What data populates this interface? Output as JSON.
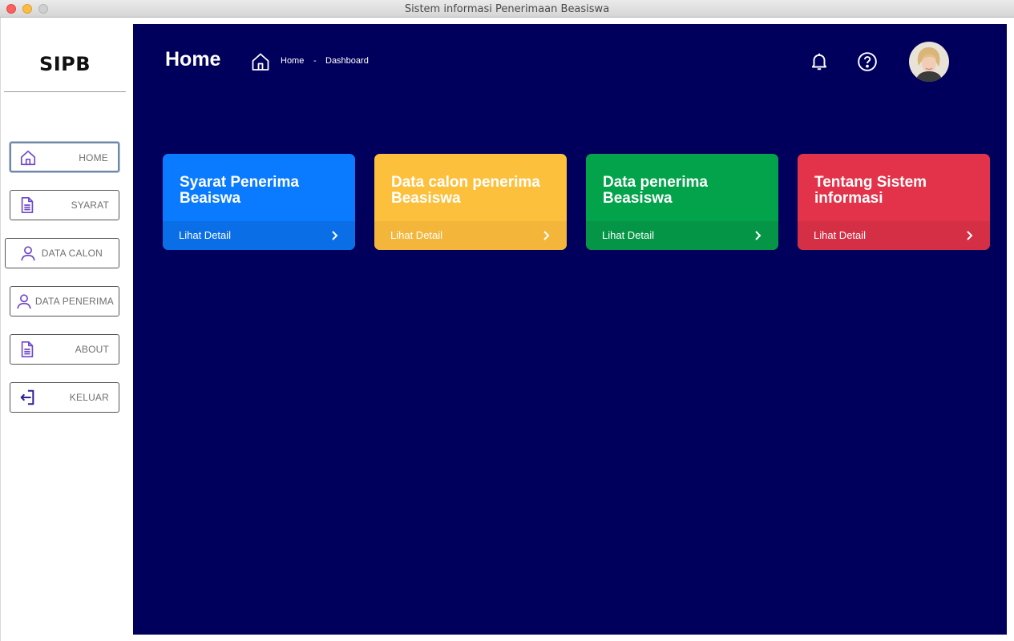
{
  "window": {
    "title": "Sistem informasi Penerimaan Beasiswa"
  },
  "sidebar": {
    "logo": "SIPB",
    "items": [
      {
        "label": "HOME",
        "icon": "home-icon"
      },
      {
        "label": "SYARAT",
        "icon": "document-icon"
      },
      {
        "label": "DATA CALON",
        "icon": "user-icon"
      },
      {
        "label": "DATA PENERIMA",
        "icon": "user-icon"
      },
      {
        "label": "ABOUT",
        "icon": "document-icon"
      },
      {
        "label": "KELUAR",
        "icon": "logout-icon"
      }
    ],
    "active": "HOME"
  },
  "header": {
    "title": "Home",
    "breadcrumb": {
      "home": "Home",
      "separator": "-",
      "current": "Dashboard"
    },
    "icons": [
      "bell-icon",
      "help-icon",
      "avatar"
    ]
  },
  "cards": [
    {
      "title": "Syarat Penerima Beaiswa",
      "link": "Lihat Detail",
      "color": "#0a7bff",
      "footer_color": "#0a6fe6"
    },
    {
      "title": "Data calon penerima Beasiswa",
      "link": "Lihat Detail",
      "color": "#fdc03c",
      "footer_color": "#f3b63a"
    },
    {
      "title": "Data penerima Beasiswa",
      "link": "Lihat Detail",
      "color": "#02a34a",
      "footer_color": "#049646"
    },
    {
      "title": "Tentang Sistem informasi",
      "link": "Lihat Detail",
      "color": "#e3334a",
      "footer_color": "#d42f45"
    }
  ],
  "colors": {
    "main_bg": "#00005c",
    "nav_icon": "#6e49c7"
  }
}
